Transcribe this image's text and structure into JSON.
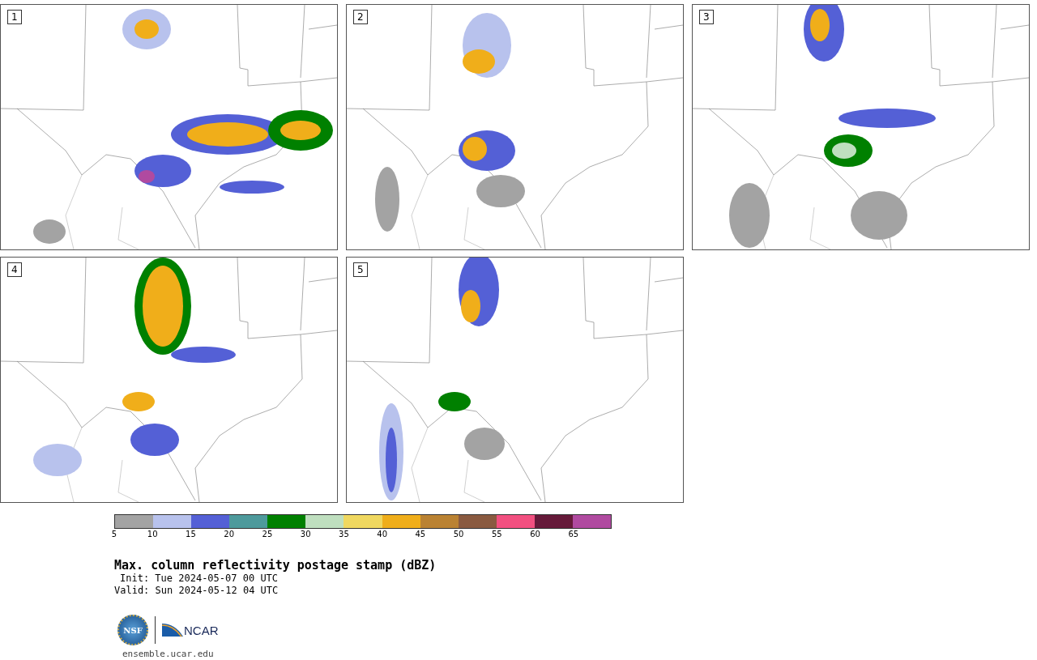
{
  "panels": [
    {
      "label": "1"
    },
    {
      "label": "2"
    },
    {
      "label": "3"
    },
    {
      "label": "4"
    },
    {
      "label": "5"
    }
  ],
  "colorbar": {
    "bins": [
      {
        "color": "#a3a3a3"
      },
      {
        "color": "#b8c2ed"
      },
      {
        "color": "#5460d6"
      },
      {
        "color": "#4e9a9c"
      },
      {
        "color": "#008000"
      },
      {
        "color": "#bfdfbf"
      },
      {
        "color": "#f0d860"
      },
      {
        "color": "#f0ae1a"
      },
      {
        "color": "#ba8232"
      },
      {
        "color": "#8a5a40"
      },
      {
        "color": "#f25080"
      },
      {
        "color": "#661a3a"
      },
      {
        "color": "#b04aa0"
      }
    ],
    "ticks": [
      "5",
      "10",
      "15",
      "20",
      "25",
      "30",
      "35",
      "40",
      "45",
      "50",
      "55",
      "60",
      "65"
    ]
  },
  "title": "Max. column reflectivity postage stamp (dBZ)",
  "init": "Init: Tue 2024-05-07 00 UTC",
  "valid": "Valid: Sun 2024-05-12 04 UTC",
  "logos": {
    "nsf": "NSF",
    "ncar": "NCAR"
  },
  "site": "ensemble.ucar.edu"
}
